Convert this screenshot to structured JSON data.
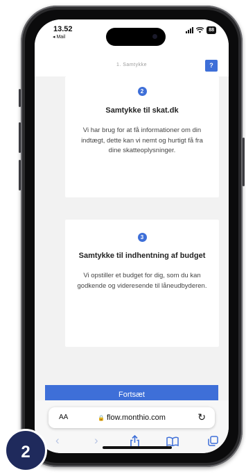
{
  "status_bar": {
    "time": "13.52",
    "back_app": "◂ Mail",
    "battery": "88"
  },
  "header": {
    "title": "1. Samtykke",
    "help_label": "?"
  },
  "cards": [
    {
      "number": "2",
      "title": "Samtykke til skat.dk",
      "text": "Vi har brug for at få informationer om din indtægt, dette kan vi nemt og hurtigt få fra dine skatteoplysninger."
    },
    {
      "number": "3",
      "title": "Samtykke til indhentning af budget",
      "text": "Vi opstiller et budget for dig, som du kan godkende og videresende til låneudbyderen."
    }
  ],
  "continue_button": "Fortsæt",
  "browser": {
    "aa_label": "AA",
    "url": "flow.monthio.com",
    "icons": [
      "back-icon",
      "forward-icon",
      "share-icon",
      "bookmarks-icon",
      "tabs-icon",
      "reload-icon",
      "lock-icon"
    ]
  },
  "step_badge": "2",
  "colors": {
    "accent": "#3e6fd8",
    "badge_navy": "#1f2a5c",
    "page_background": "#f2f2f2"
  }
}
